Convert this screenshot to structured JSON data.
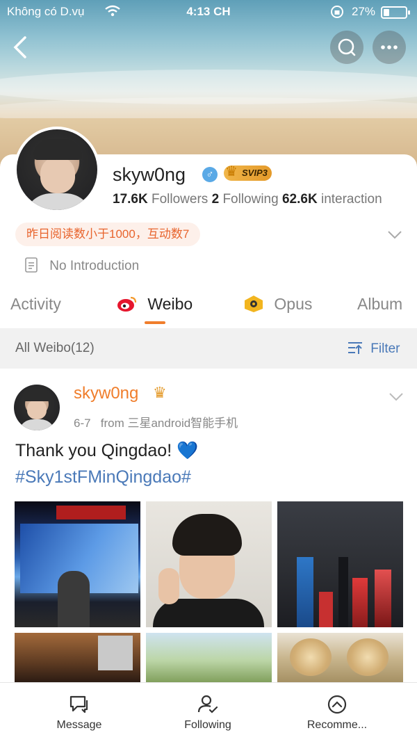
{
  "status_bar": {
    "carrier": "Không có D.vụ",
    "time": "4:13 CH",
    "battery": "27%"
  },
  "profile": {
    "username": "skyw0ng",
    "vip_badge": "SVIP3",
    "stats": {
      "followers_value": "17.6K",
      "followers_label": "Followers",
      "following_value": "2",
      "following_label": "Following",
      "interaction_value": "62.6K",
      "interaction_label": "interaction"
    },
    "tag_text": "昨日阅读数小于1000，互动数7",
    "introduction": "No Introduction"
  },
  "tabs": [
    {
      "label": "Activity",
      "active": false
    },
    {
      "label": "Weibo",
      "active": true
    },
    {
      "label": "Opus",
      "active": false
    },
    {
      "label": "Album",
      "active": false
    }
  ],
  "filter_bar": {
    "count_label": "All Weibo(12)",
    "filter_label": "Filter"
  },
  "post": {
    "author": "skyw0ng",
    "date": "6-7",
    "source": "from 三星android智能手机",
    "text": "Thank you Qingdao! 💙",
    "hashtag": "#Sky1stFMinQingdao#"
  },
  "bottom_nav": [
    {
      "label": "Message",
      "icon": "message-icon"
    },
    {
      "label": "Following",
      "icon": "user-check-icon"
    },
    {
      "label": "Recomme...",
      "icon": "chevron-up-circle-icon"
    }
  ],
  "colors": {
    "accent_orange": "#f07e2c",
    "link_blue": "#4a79b8",
    "tag_bg": "#fdf0ea",
    "tag_text": "#e8642d"
  }
}
